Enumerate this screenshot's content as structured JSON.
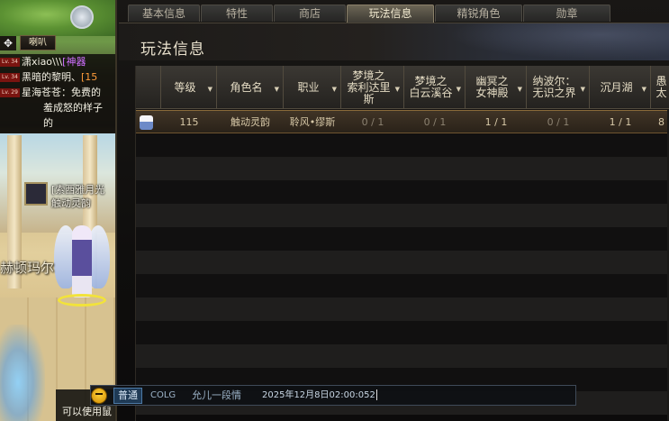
{
  "scene": {
    "horn_button": "喇叭",
    "town_name": "赫顿玛尔",
    "npc_title": "[索西雅月光",
    "npc_name": "触动灵韵",
    "bottom_hint": "可以使用鼠"
  },
  "chat_lines": [
    {
      "lv": "Lv. 34",
      "name": "潇xiao\\\\\\",
      "extra": "[神器",
      "extra_color": "purple"
    },
    {
      "lv": "Lv. 34",
      "name": "黑暗的黎明、",
      "extra": "[15",
      "extra_color": "orange"
    },
    {
      "lv": "Lv. 29",
      "name": "星海苍苍",
      "extra": "：免费的",
      "extra_color": "white"
    },
    {
      "lv": "",
      "name": "羞成怒的样子",
      "extra": "",
      "extra_color": "white"
    },
    {
      "lv": "",
      "name": "的",
      "extra": "",
      "extra_color": "white"
    }
  ],
  "tabs": [
    {
      "label": "基本信息",
      "active": false
    },
    {
      "label": "特性",
      "active": false
    },
    {
      "label": "商店",
      "active": false
    },
    {
      "label": "玩法信息",
      "active": true
    },
    {
      "label": "精锐角色",
      "active": false
    },
    {
      "label": "勋章",
      "active": false
    }
  ],
  "panel_title": "玩法信息",
  "table": {
    "columns": [
      "等级",
      "角色名",
      "职业",
      "梦境之\n索利达里\n斯",
      "梦境之\n白云溪谷",
      "幽冥之\n女神殿",
      "纳波尔：\n无识之界",
      "沉月湖",
      "愚\n太"
    ],
    "rows": [
      {
        "level": "115",
        "name": "触动灵韵",
        "class": "聆风•缪斯",
        "c1": "0 / 1",
        "c2": "0 / 1",
        "c3": "1 / 1",
        "c4": "0 / 1",
        "c5": "1 / 1",
        "c6": "8"
      }
    ]
  },
  "chat_input": {
    "channel": "普通",
    "guild": "COLG",
    "player": "允儿一段情",
    "text": "2025年12月8日02:00:052"
  }
}
